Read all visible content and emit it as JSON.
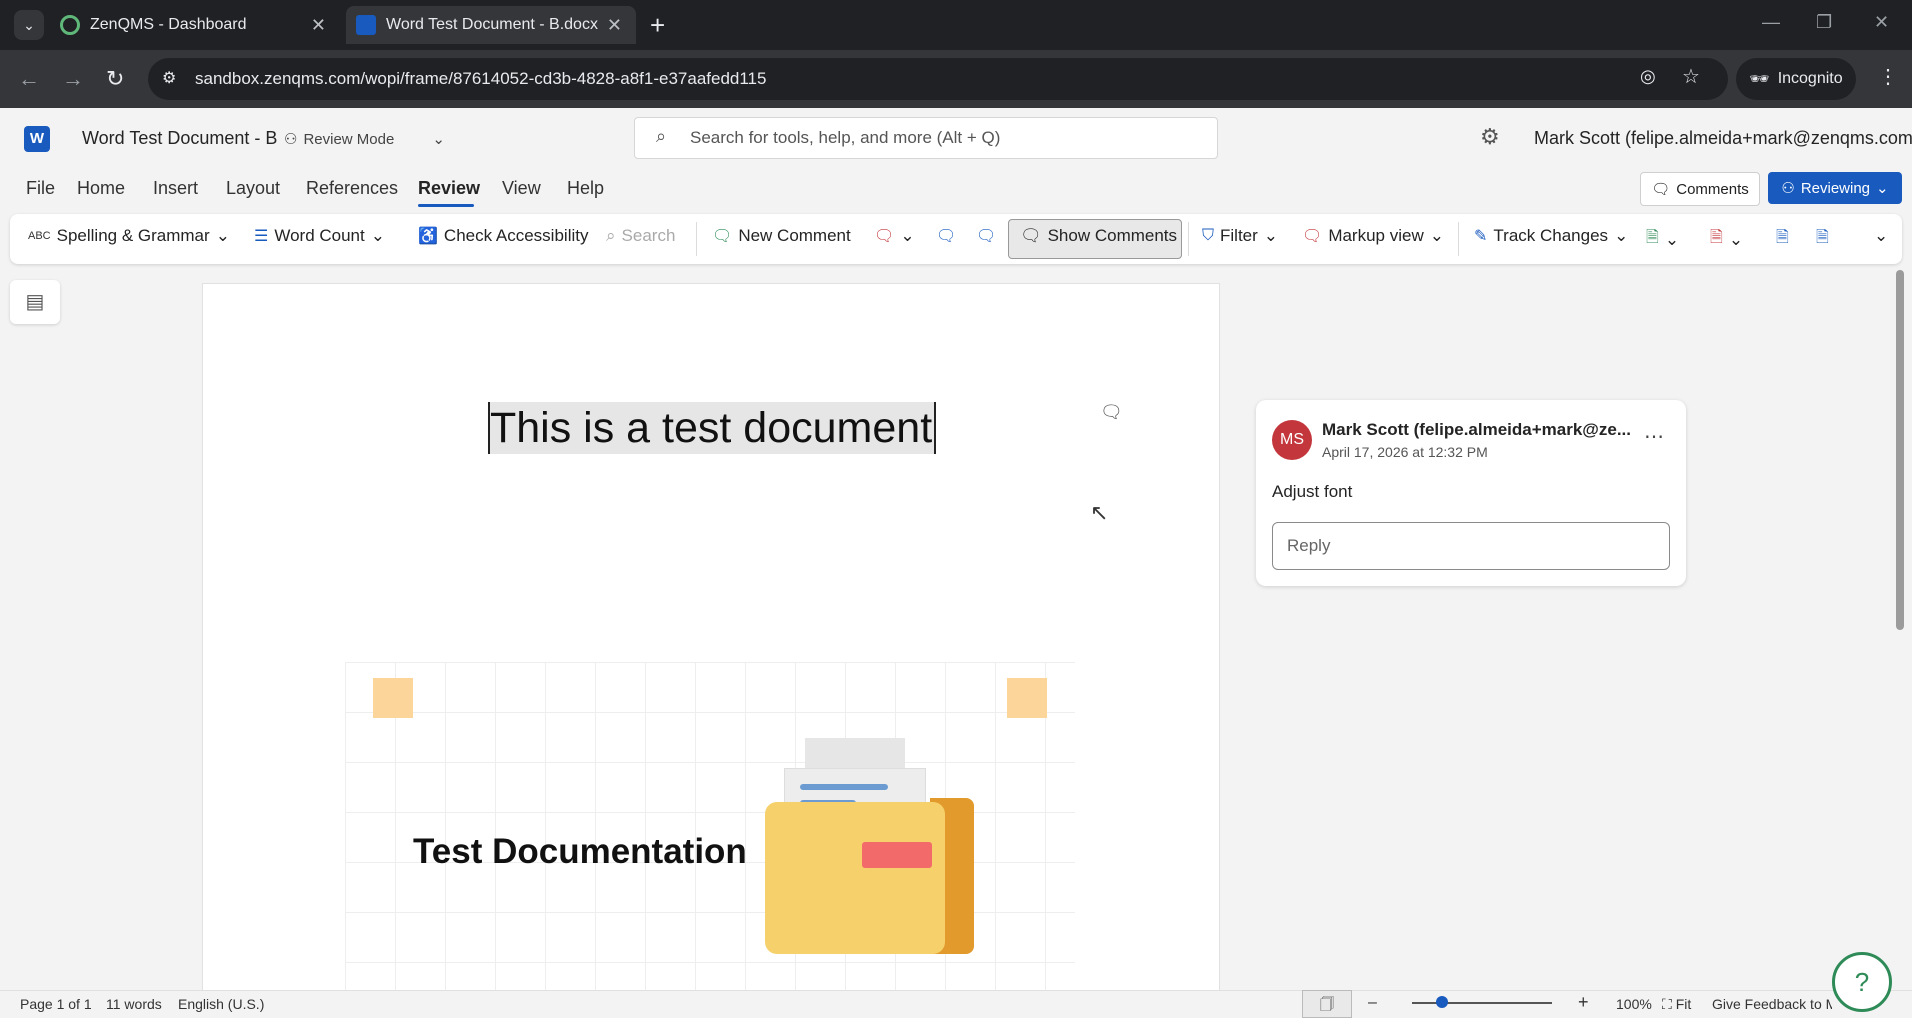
{
  "browser": {
    "tabs": [
      {
        "title": "ZenQMS - Dashboard"
      },
      {
        "title": "Word Test Document - B.docx"
      }
    ],
    "url": "sandbox.zenqms.com/wopi/frame/87614052-cd3b-4828-a8f1-e37aafedd115",
    "incognito_label": "Incognito"
  },
  "word": {
    "doc_title": "Word Test Document - B",
    "review_mode": "Review Mode",
    "search_placeholder": "Search for tools, help, and more (Alt + Q)",
    "user": "Mark Scott (felipe.almeida+mark@zenqms.com)",
    "menu": [
      "File",
      "Home",
      "Insert",
      "Layout",
      "References",
      "Review",
      "View",
      "Help"
    ],
    "comments_button": "Comments",
    "reviewing_button": "Reviewing"
  },
  "ribbon": {
    "spelling": "Spelling & Grammar",
    "word_count": "Word Count",
    "check_accessibility": "Check Accessibility",
    "search": "Search",
    "new_comment": "New Comment",
    "show_comments": "Show Comments",
    "filter": "Filter",
    "markup_view": "Markup view",
    "track_changes": "Track Changes"
  },
  "document": {
    "heading": "This is a test document",
    "illustration_title": "Test Documentation"
  },
  "comment": {
    "initials": "MS",
    "author": "Mark Scott (felipe.almeida+mark@ze...",
    "date": "April 17, 2026 at 12:32 PM",
    "body": "Adjust font",
    "reply_placeholder": "Reply"
  },
  "status": {
    "page": "Page 1 of 1",
    "words": "11 words",
    "language": "English (U.S.)",
    "zoom": "100%",
    "fit": "Fit",
    "feedback": "Give Feedback to Microsoft"
  },
  "colors": {
    "accent": "#185abd",
    "avatar": "#c3373c"
  }
}
